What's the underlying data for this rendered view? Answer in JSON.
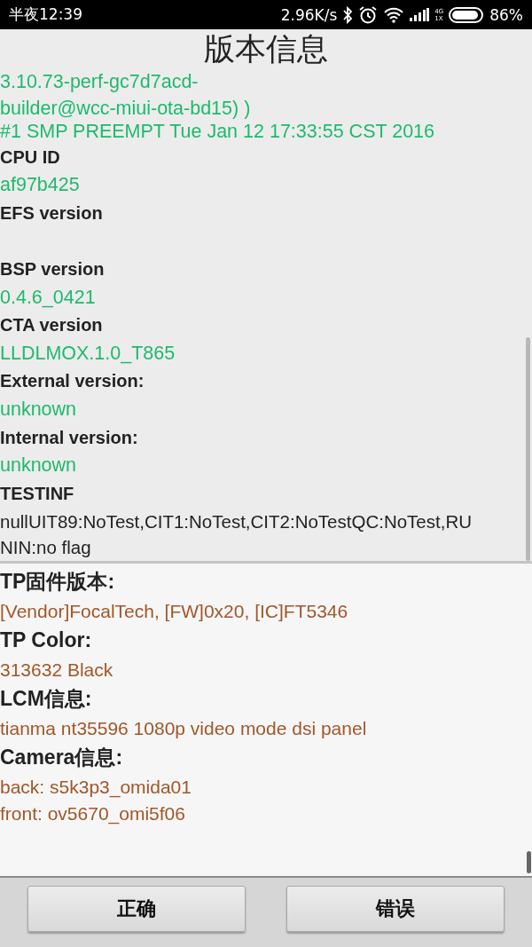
{
  "status_bar": {
    "time": "半夜12:39",
    "speed": "2.96K/s",
    "network_top": "4G",
    "network_bottom": "1X",
    "battery": "86%"
  },
  "title": "版本信息",
  "upper_list": [
    {
      "kind": "value",
      "text": "3.10.73-perf-gc7d7acd-"
    },
    {
      "kind": "cont",
      "text": "builder@wcc-miui-ota-bd15) )"
    },
    {
      "kind": "cont",
      "text": "#1 SMP PREEMPT Tue Jan 12 17:33:55 CST 2016"
    },
    {
      "kind": "label",
      "text": "CPU ID"
    },
    {
      "kind": "value",
      "text": "af97b425"
    },
    {
      "kind": "label",
      "text": "EFS version"
    },
    {
      "kind": "gap"
    },
    {
      "kind": "label",
      "text": "BSP version"
    },
    {
      "kind": "value",
      "text": "0.4.6_0421"
    },
    {
      "kind": "label",
      "text": "CTA version"
    },
    {
      "kind": "value",
      "text": "LLDLMOX.1.0_T865"
    },
    {
      "kind": "label",
      "text": "External version:"
    },
    {
      "kind": "value",
      "text": "unknown"
    },
    {
      "kind": "label",
      "text": "Internal version:"
    },
    {
      "kind": "value",
      "text": "unknown"
    },
    {
      "kind": "label",
      "text": "TESTINF"
    },
    {
      "kind": "plain",
      "text": "nullUIT89:NoTest,CIT1:NoTest,CIT2:NoTestQC:NoTest,RU"
    },
    {
      "kind": "plaincont",
      "text": "NIN:no flag"
    }
  ],
  "lower_list": [
    {
      "kind": "label",
      "text": "TP固件版本:"
    },
    {
      "kind": "value",
      "text": "[Vendor]FocalTech, [FW]0x20, [IC]FT5346"
    },
    {
      "kind": "label",
      "text": "TP Color:"
    },
    {
      "kind": "value",
      "text": "313632  Black"
    },
    {
      "kind": "label",
      "text": "LCM信息:"
    },
    {
      "kind": "value",
      "text": "tianma nt35596 1080p video mode dsi panel"
    },
    {
      "kind": "label",
      "text": "Camera信息:"
    },
    {
      "kind": "value",
      "text": "back: s5k3p3_omida01"
    },
    {
      "kind": "cont",
      "text": "front: ov5670_omi5f06"
    }
  ],
  "buttons": [
    "正确",
    "错误"
  ]
}
